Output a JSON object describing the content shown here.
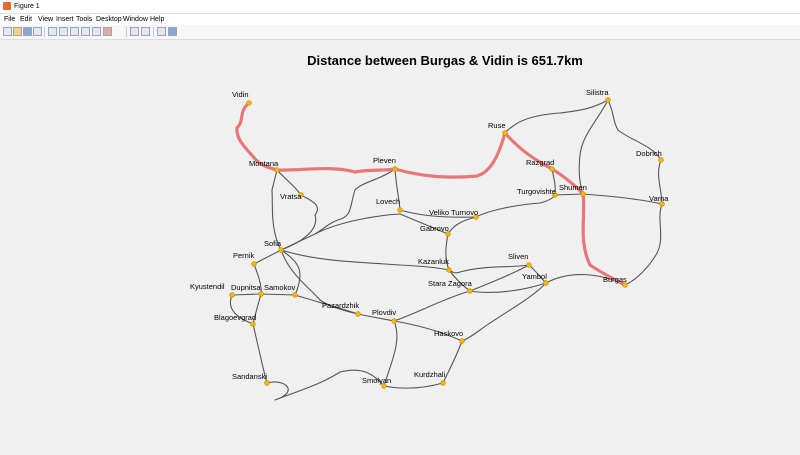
{
  "window": {
    "title": "Figure 1"
  },
  "menu": [
    "File",
    "Edit",
    "View",
    "Insert",
    "Tools",
    "Desktop",
    "Window",
    "Help"
  ],
  "toolbar": {
    "buttons": [
      "new-figure-icon",
      "open-file-icon",
      "save-icon",
      "print-icon",
      "zoom-in-icon",
      "zoom-out-icon",
      "pan-icon",
      "rotate-icon",
      "data-cursor-icon",
      "brush-icon",
      "colorbar-icon",
      "legend-icon",
      "hide-plot-tools-icon",
      "show-plot-tools-icon"
    ]
  },
  "figure": {
    "title": "Distance between Burgas & Vidin is 651.7km",
    "route_color": "#e8777a",
    "road_color": "#555555",
    "node_color": "#f5b800",
    "cities": [
      "Vidin",
      "Silistra",
      "Ruse",
      "Dobrich",
      "Razgrad",
      "Montana",
      "Pleven",
      "Shumen",
      "Varna",
      "Vratsa",
      "Turgovishte",
      "Lovech",
      "Veliko Turnovo",
      "Gabrovo",
      "Sofia",
      "Sliven",
      "Pernik",
      "Kazanluk",
      "Yambol",
      "Burgas",
      "Stara Zagora",
      "Kyustendil",
      "Dupnitsa",
      "Samokov",
      "Pazardzhik",
      "Plovdiv",
      "Blagoevgrad",
      "Haskovo",
      "Sandanski",
      "Kurdzhali",
      "Smolyan"
    ]
  }
}
